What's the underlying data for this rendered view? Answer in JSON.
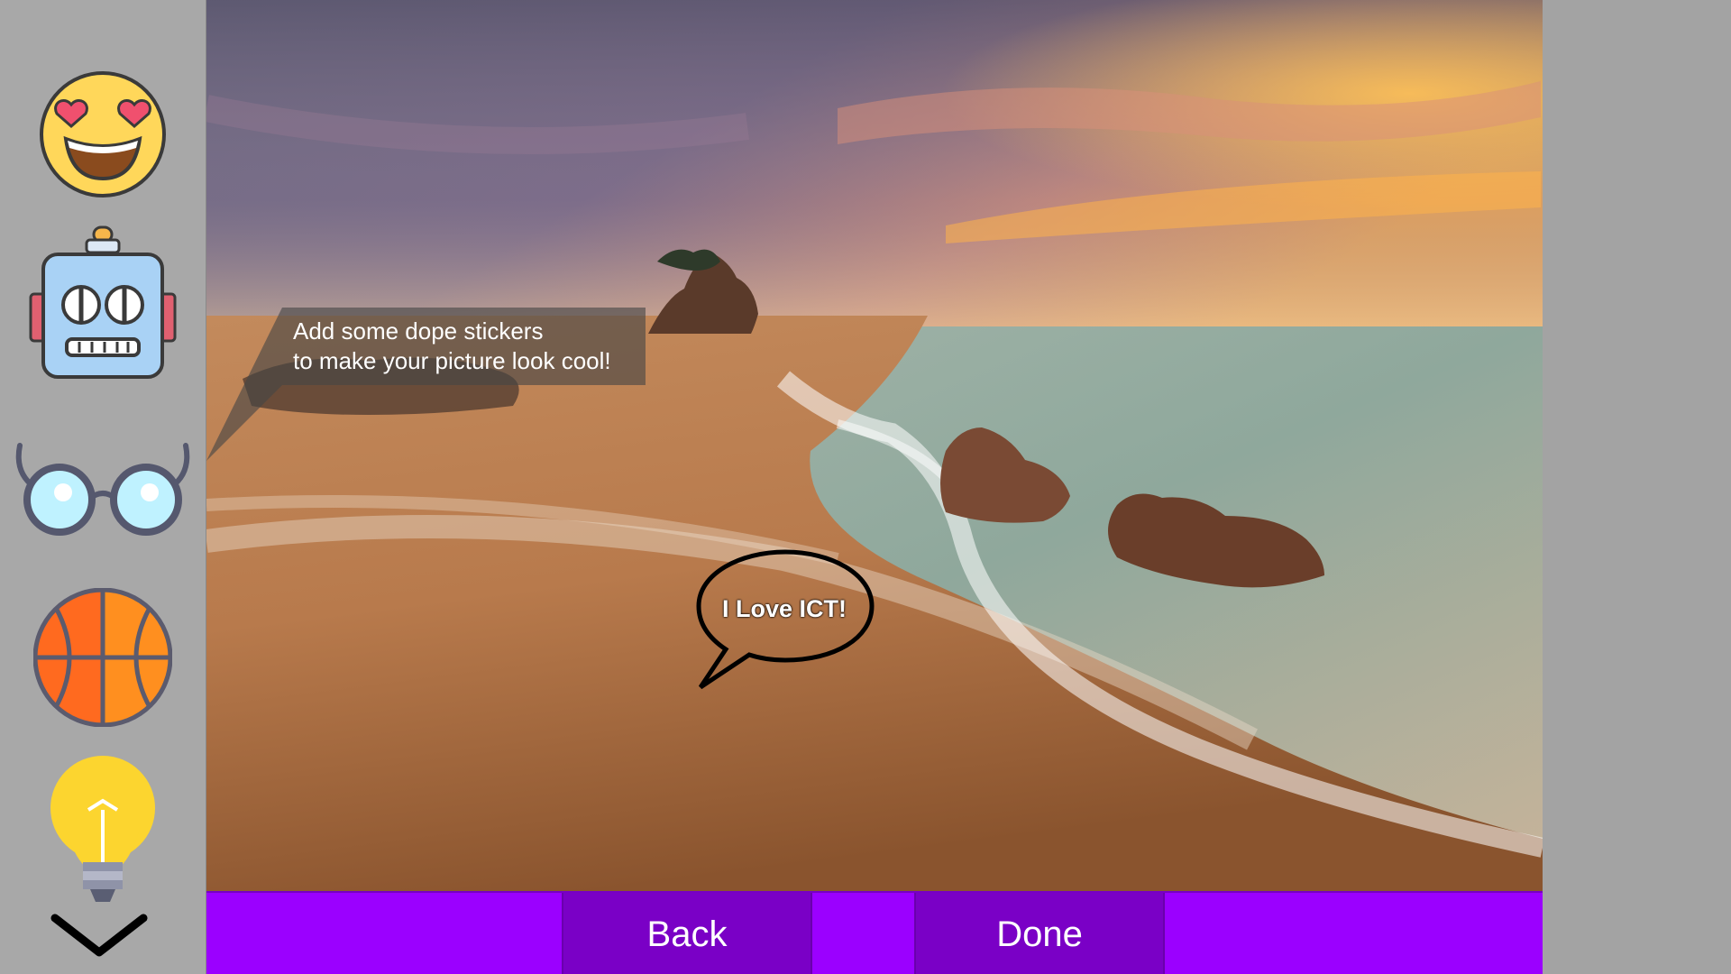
{
  "sidebar": {
    "stickers": [
      {
        "name": "heart-eyes-emoji-icon"
      },
      {
        "name": "robot-face-icon"
      },
      {
        "name": "eyeglasses-icon"
      },
      {
        "name": "basketball-icon"
      },
      {
        "name": "light-bulb-icon"
      }
    ],
    "more_icon": "chevron-down-icon"
  },
  "canvas": {
    "tooltip": {
      "line1": "Add some dope stickers",
      "line2": "to make your picture look cool!"
    },
    "speech_bubble": {
      "text": "I Love ICT!"
    }
  },
  "bottom_bar": {
    "back_label": "Back",
    "done_label": "Done"
  },
  "colors": {
    "accent": "#9b00ff",
    "button": "#7a00c6",
    "sidebar": "#a8a8a8"
  }
}
